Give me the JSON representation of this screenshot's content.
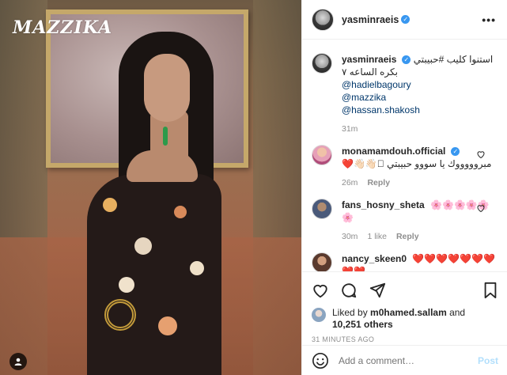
{
  "header": {
    "username": "yasminraeis",
    "more_label": "•••"
  },
  "photo": {
    "logo_text": "MAZZIKA"
  },
  "caption": {
    "username": "yasminraeis",
    "line1": "استنوا كليب #حبيبتي",
    "line2": "بكره الساعه ٧",
    "mentions": [
      "@hadielbagoury",
      "@mazzika",
      "@hassan.shakosh"
    ],
    "time": "31m"
  },
  "comments": [
    {
      "username": "monamamdouh.official",
      "verified": true,
      "text": "مبروووووك يا سووو حبيبتي 🏻👋🏻👋🏻❤️",
      "time": "26m",
      "likes": "",
      "reply": "Reply"
    },
    {
      "username": "fans_hosny_sheta",
      "verified": false,
      "text": "🌸🌸🌸🌸🌸🌸",
      "time": "30m",
      "likes": "1 like",
      "reply": "Reply"
    },
    {
      "username": "nancy_skeen0",
      "verified": false,
      "text": "❤️❤️❤️❤️❤️❤️❤️❤️❤️",
      "time": "",
      "likes": "",
      "reply": ""
    }
  ],
  "likes": {
    "prefix": "Liked by ",
    "user": "m0hamed.sallam",
    "middle": " and",
    "others": "10,251 others"
  },
  "timestamp": "31 MINUTES AGO",
  "add_comment": {
    "placeholder": "Add a comment…",
    "post_label": "Post"
  },
  "colors": {
    "link": "#00376b",
    "verified": "#3897f0",
    "muted": "#8e8e8e",
    "post_disabled": "#b2dffc"
  },
  "icons": [
    "heart-icon",
    "comment-icon",
    "share-icon",
    "bookmark-icon",
    "emoji-icon",
    "user-tag-icon",
    "verified-icon",
    "more-icon"
  ]
}
